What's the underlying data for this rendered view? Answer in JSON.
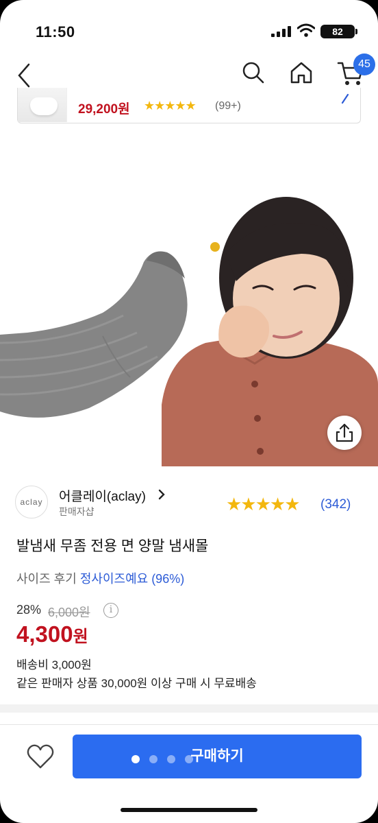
{
  "status_bar": {
    "time": "11:50",
    "battery": "82",
    "icons": [
      "signal-icon",
      "wifi-icon",
      "battery-icon"
    ]
  },
  "nav": {
    "icons": [
      "back-icon",
      "search-icon",
      "home-icon",
      "cart-icon"
    ],
    "cart_count": "45"
  },
  "recommendation": {
    "price": "29,200원",
    "stars": "★★★★★",
    "rating_fraction": 0.9,
    "review_count": "(99+)"
  },
  "product": {
    "image_icons": [
      "sock-image",
      "child-image"
    ],
    "share_icon": "share-icon"
  },
  "seller": {
    "logo_text": "aclay",
    "name": "어클레이(aclay)",
    "type": "판매자샵",
    "stars": "★★★★★",
    "review_count": "(342)"
  },
  "title": "발냄새 무좀 전용 면 양말 냄새몰",
  "size_review": {
    "label": "사이즈 후기",
    "value": "정사이즈예요 (96%)"
  },
  "pricing": {
    "discount": "28%",
    "original_price": "6,000원",
    "info_icon": "i",
    "price": "4,300",
    "price_unit": "원",
    "shipping": "배송비 3,000원",
    "free_shipping_note": "같은 판매자 상품 30,000원 이상 구매 시 무료배송"
  },
  "bottom_bar": {
    "buy_label": "구매하기",
    "page_dots": 4,
    "active_dot": 0
  },
  "colors": {
    "accent_blue": "#2b6cf0",
    "price_red": "#c1121f",
    "star_yellow": "#f3b70e",
    "link_blue": "#2c5bd6"
  }
}
